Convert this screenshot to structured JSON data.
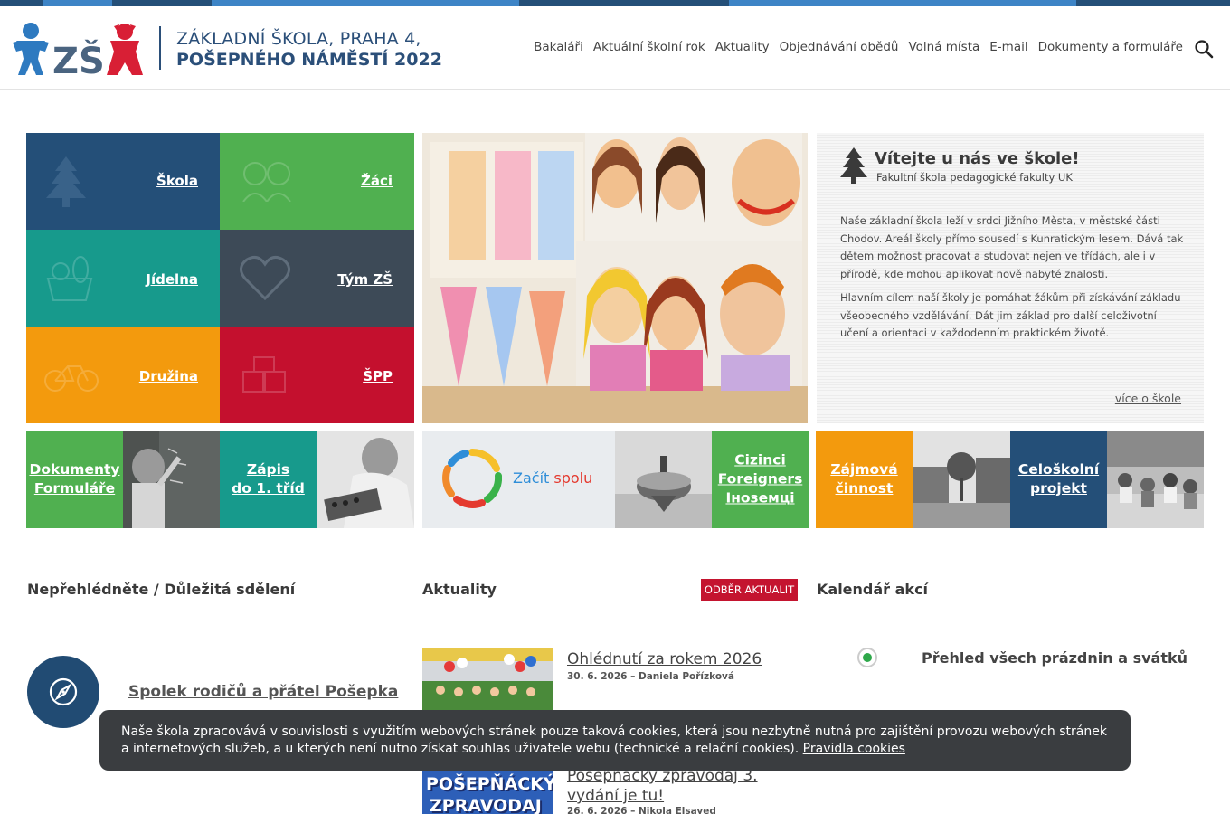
{
  "colors": {
    "blue": "#244f78",
    "green": "#50b050",
    "teal": "#179a8c",
    "slate": "#3d4a57",
    "orange": "#f39a0d",
    "red": "#c4102e",
    "accent_red": "#c4142f"
  },
  "header": {
    "school_line1": "ZÁKLADNÍ ŠKOLA, PRAHA 4,",
    "school_line2": "POŠEPNÉHO NÁMĚSTÍ 2022",
    "logo_text": "ZŠ",
    "nav": [
      "Bakaláři",
      "Aktuální školní rok",
      "Aktuality",
      "Objednávání obědů",
      "Volná místa",
      "E-mail",
      "Dokumenty a formuláře"
    ],
    "search_icon": "search-icon"
  },
  "tiles": {
    "skola": "Škola",
    "zaci": "Žáci",
    "jidelna": "Jídelna",
    "tym": "Tým ZŠ",
    "druzina": "Družina",
    "spp": "ŠPP"
  },
  "welcome": {
    "title": "Vítejte u nás ve škole!",
    "subtitle": "Fakultní škola pedagogické fakulty UK",
    "p1": "Naše základní škola leží v srdci Jižního Města, v městské části Chodov. Areál školy přímo sousedí s Kunratickým lesem. Dává tak dětem možnost pracovat a studovat nejen ve třídách, ale i v přírodě, kde mohou aplikovat nově nabyté znalosti.",
    "p2": "Hlavním cílem naší školy je pomáhat žákům při získávání základu všeobecného vzdělávání. Dát jim základ pro další celoživotní učení a orientaci v každodenním praktickém životě.",
    "more": "více o škole"
  },
  "small_tiles": {
    "dokumenty_l1": "Dokumenty",
    "dokumenty_l2": "Formuláře",
    "zapis_l1": "Zápis",
    "zapis_l2": "do 1. tříd",
    "zacit_brand1": "Začít",
    "zacit_brand2": "spolu",
    "cizinci_l1": "Cizinci",
    "cizinci_l2": "Foreigners",
    "cizinci_l3": "Іноземці",
    "zajmova_l1": "Zájmová",
    "zajmova_l2": "činnost",
    "projekt_l1": "Celoškolní",
    "projekt_l2": "projekt"
  },
  "sections": {
    "important": "Nepřehlédněte / Důležitá sdělení",
    "news": "Aktuality",
    "subscribe": "ODBĚR AKTUALIT",
    "calendar": "Kalendář akcí"
  },
  "important": {
    "link": "Spolek rodičů a přátel Pošepka"
  },
  "news": [
    {
      "title": "Ohlédnutí za rokem 2026",
      "meta": "30. 6. 2026 – Daniela Pořízková"
    },
    {
      "title": "Pošepňácký zpravodaj 3. vydání je tu!",
      "meta": "26. 6. 2026 – Nikola Elsayed",
      "thumb_text_1": "POŠEPŇÁCKÝ",
      "thumb_text_2": "ZPRAVODAJ"
    }
  ],
  "calendar": {
    "item": "Přehled všech prázdnin a svátků"
  },
  "cookie": {
    "text": "Naše škola zpracovává v souvislosti s využitím webových stránek pouze taková cookies, která jsou nezbytně nutná pro zajištění provozu webových stránek a internetových služeb, a u kterých není nutno získat souhlas uživatele webu (technické a relační cookies).",
    "link": "Pravidla cookies"
  }
}
